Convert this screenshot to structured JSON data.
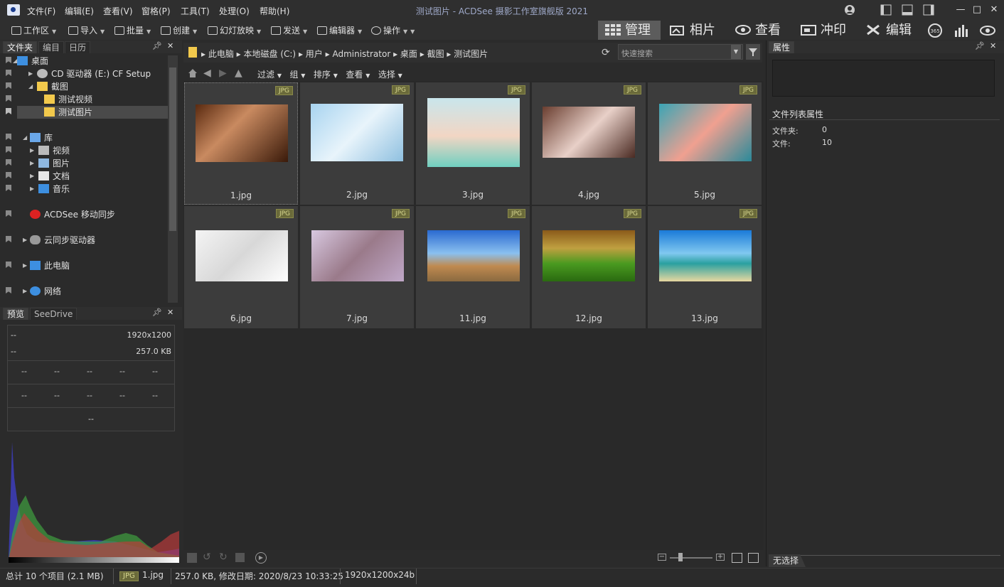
{
  "window": {
    "title": "测试图片 - ACDSee 摄影工作室旗舰版 2021"
  },
  "menu": [
    "文件(F)",
    "编辑(E)",
    "查看(V)",
    "窗格(P)",
    "工具(T)",
    "处理(O)",
    "帮助(H)"
  ],
  "toolbar": {
    "items": [
      "工作区",
      "导入",
      "批量",
      "创建",
      "幻灯放映",
      "发送",
      "编辑器",
      "操作"
    ]
  },
  "modes": [
    "管理",
    "相片",
    "查看",
    "冲印",
    "编辑"
  ],
  "left_tabs": [
    "文件夹",
    "编目",
    "日历"
  ],
  "tree": {
    "desktop": "桌面",
    "cd_drive": "CD 驱动器 (E:) CF Setup",
    "screenshots": "截图",
    "test_video": "测试视频",
    "test_images": "测试图片",
    "library": "库",
    "videos": "视频",
    "pictures": "图片",
    "documents": "文档",
    "music": "音乐",
    "acdsee_sync": "ACDSee 移动同步",
    "cloud_drives": "云同步驱动器",
    "this_pc": "此电脑",
    "network": "网络"
  },
  "preview_tabs": [
    "预览",
    "SeeDrive"
  ],
  "preview_info": {
    "top_left_1": "--",
    "resolution": "1920x1200",
    "top_left_2": "--",
    "size": "257.0 KB",
    "dash": "--",
    "bottom": "--"
  },
  "breadcrumb": [
    "此电脑",
    "本地磁盘 (C:)",
    "用户",
    "Administrator",
    "桌面",
    "截图",
    "测试图片"
  ],
  "search": {
    "placeholder": "快速搜索"
  },
  "filter_bar": [
    "过滤",
    "组",
    "排序",
    "查看",
    "选择"
  ],
  "files": [
    {
      "name": "1.jpg",
      "badge": "JPG"
    },
    {
      "name": "2.jpg",
      "badge": "JPG"
    },
    {
      "name": "3.jpg",
      "badge": "JPG"
    },
    {
      "name": "4.jpg",
      "badge": "JPG"
    },
    {
      "name": "5.jpg",
      "badge": "JPG"
    },
    {
      "name": "6.jpg",
      "badge": "JPG"
    },
    {
      "name": "7.jpg",
      "badge": "JPG"
    },
    {
      "name": "11.jpg",
      "badge": "JPG"
    },
    {
      "name": "12.jpg",
      "badge": "JPG"
    },
    {
      "name": "13.jpg",
      "badge": "JPG"
    }
  ],
  "properties": {
    "tab": "属性",
    "section": "文件列表属性",
    "folders_label": "文件夹:",
    "folders_value": "0",
    "files_label": "文件:",
    "files_value": "10",
    "no_selection": "无选择"
  },
  "status": {
    "total": "总计 10 个项目  (2.1 MB)",
    "badge": "JPG",
    "filename": "1.jpg",
    "info": "257.0 KB, 修改日期: 2020/8/23 10:33:25",
    "dims": "1920x1200x24b"
  },
  "colors": {
    "accent_badge": "#6a6a3a",
    "selection": "#4a4a4a"
  }
}
